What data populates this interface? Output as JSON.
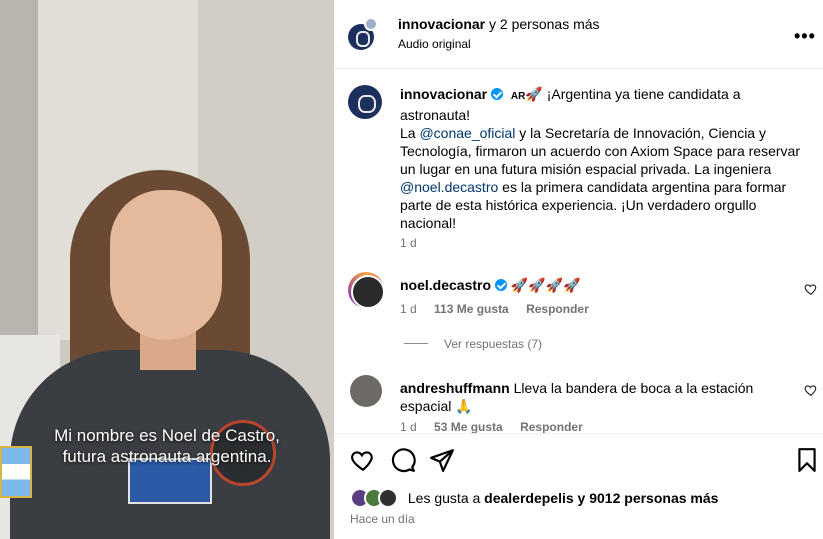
{
  "video": {
    "caption_line1": "Mi nombre es Noel de Castro,",
    "caption_line2": "futura astronauta argentina."
  },
  "header": {
    "author": "innovacionar",
    "coauthors": "y 2 personas más",
    "audio": "Audio original",
    "more_icon": "more-horizontal-icon"
  },
  "post": {
    "username": "innovacionar",
    "flag_text": "AR",
    "rocket_emoji": "🚀",
    "text_part1": " ¡Argentina ya tiene candidata a astronauta!",
    "text_part2": "La ",
    "mention1": "@conae_oficial",
    "text_part3": " y la Secretaría de Innovación, Ciencia y Tecnología, firmaron un acuerdo con Axiom Space para reservar un lugar en una futura misión espacial privada. La ingeniera ",
    "mention2": "@noel.decastro",
    "text_part4": " es la primera candidata argentina para formar parte de esta histórica experiencia. ¡Un verdadero orgullo nacional!",
    "time": "1 d"
  },
  "comments": [
    {
      "username": "noel.decastro",
      "text": "🚀🚀🚀🚀",
      "time": "1 d",
      "likes": "113 Me gusta",
      "reply": "Responder",
      "view_replies": "Ver respuestas (7)"
    },
    {
      "username": "andreshuffmann",
      "text": "Lleva la bandera de boca a la estación espacial 🙏",
      "time": "1 d",
      "likes": "53 Me gusta",
      "reply": "Responder"
    }
  ],
  "actions": {
    "likes_prefix": "Les gusta a ",
    "likes_user": "dealerdepelis",
    "likes_suffix": " y 9012 personas más",
    "posted_ago": "Hace un día"
  },
  "colors": {
    "verified": "#0095f6",
    "mention": "#00376b",
    "muted": "#737373"
  }
}
